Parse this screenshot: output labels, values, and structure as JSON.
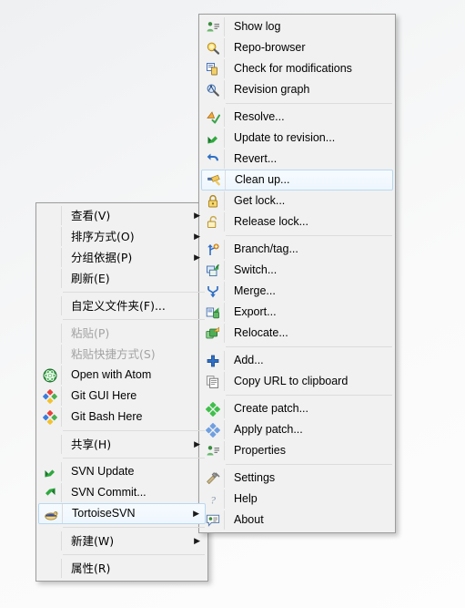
{
  "context_menu": {
    "name": "explorer-folder-context-menu",
    "items": [
      {
        "label": "查看(V)",
        "icon": null,
        "submenu": true,
        "disabled": false,
        "selected": false
      },
      {
        "label": "排序方式(O)",
        "icon": null,
        "submenu": true,
        "disabled": false,
        "selected": false
      },
      {
        "label": "分组依据(P)",
        "icon": null,
        "submenu": true,
        "disabled": false,
        "selected": false
      },
      {
        "label": "刷新(E)",
        "icon": null,
        "submenu": false,
        "disabled": false,
        "selected": false
      },
      {
        "separator": true
      },
      {
        "label": "自定义文件夹(F)...",
        "icon": null,
        "submenu": false,
        "disabled": false,
        "selected": false
      },
      {
        "separator": true
      },
      {
        "label": "粘贴(P)",
        "icon": null,
        "submenu": false,
        "disabled": true,
        "selected": false
      },
      {
        "label": "粘贴快捷方式(S)",
        "icon": null,
        "submenu": false,
        "disabled": true,
        "selected": false
      },
      {
        "label": "Open with Atom",
        "icon": "atom-icon",
        "submenu": false,
        "disabled": false,
        "selected": false
      },
      {
        "label": "Git GUI Here",
        "icon": "git-icon",
        "submenu": false,
        "disabled": false,
        "selected": false
      },
      {
        "label": "Git Bash Here",
        "icon": "git-icon",
        "submenu": false,
        "disabled": false,
        "selected": false
      },
      {
        "separator": true
      },
      {
        "label": "共享(H)",
        "icon": null,
        "submenu": true,
        "disabled": false,
        "selected": false
      },
      {
        "separator": true
      },
      {
        "label": "SVN Update",
        "icon": "svn-update-icon",
        "submenu": false,
        "disabled": false,
        "selected": false
      },
      {
        "label": "SVN Commit...",
        "icon": "svn-commit-icon",
        "submenu": false,
        "disabled": false,
        "selected": false
      },
      {
        "label": "TortoiseSVN",
        "icon": "tortoise-icon",
        "submenu": true,
        "disabled": false,
        "selected": true
      },
      {
        "separator": true
      },
      {
        "label": "新建(W)",
        "icon": null,
        "submenu": true,
        "disabled": false,
        "selected": false
      },
      {
        "separator": true
      },
      {
        "label": "属性(R)",
        "icon": null,
        "submenu": false,
        "disabled": false,
        "selected": false
      }
    ]
  },
  "tortoise_submenu": {
    "name": "tortoisesvn-submenu",
    "items": [
      {
        "label": "Show log",
        "icon": "show-log-icon",
        "submenu": false,
        "disabled": false,
        "selected": false
      },
      {
        "label": "Repo-browser",
        "icon": "repo-browser-icon",
        "submenu": false,
        "disabled": false,
        "selected": false
      },
      {
        "label": "Check for modifications",
        "icon": "check-mods-icon",
        "submenu": false,
        "disabled": false,
        "selected": false
      },
      {
        "label": "Revision graph",
        "icon": "revision-graph-icon",
        "submenu": false,
        "disabled": false,
        "selected": false
      },
      {
        "separator": true
      },
      {
        "label": "Resolve...",
        "icon": "resolve-icon",
        "submenu": false,
        "disabled": false,
        "selected": false
      },
      {
        "label": "Update to revision...",
        "icon": "update-rev-icon",
        "submenu": false,
        "disabled": false,
        "selected": false
      },
      {
        "label": "Revert...",
        "icon": "revert-icon",
        "submenu": false,
        "disabled": false,
        "selected": false
      },
      {
        "label": "Clean up...",
        "icon": "cleanup-icon",
        "submenu": false,
        "disabled": false,
        "selected": true
      },
      {
        "label": "Get lock...",
        "icon": "lock-closed-icon",
        "submenu": false,
        "disabled": false,
        "selected": false
      },
      {
        "label": "Release lock...",
        "icon": "lock-open-icon",
        "submenu": false,
        "disabled": false,
        "selected": false
      },
      {
        "separator": true
      },
      {
        "label": "Branch/tag...",
        "icon": "branch-tag-icon",
        "submenu": false,
        "disabled": false,
        "selected": false
      },
      {
        "label": "Switch...",
        "icon": "switch-icon",
        "submenu": false,
        "disabled": false,
        "selected": false
      },
      {
        "label": "Merge...",
        "icon": "merge-icon",
        "submenu": false,
        "disabled": false,
        "selected": false
      },
      {
        "label": "Export...",
        "icon": "export-icon",
        "submenu": false,
        "disabled": false,
        "selected": false
      },
      {
        "label": "Relocate...",
        "icon": "relocate-icon",
        "submenu": false,
        "disabled": false,
        "selected": false
      },
      {
        "separator": true
      },
      {
        "label": "Add...",
        "icon": "add-icon",
        "submenu": false,
        "disabled": false,
        "selected": false
      },
      {
        "label": "Copy URL to clipboard",
        "icon": "copy-url-icon",
        "submenu": false,
        "disabled": false,
        "selected": false
      },
      {
        "separator": true
      },
      {
        "label": "Create patch...",
        "icon": "create-patch-icon",
        "submenu": false,
        "disabled": false,
        "selected": false
      },
      {
        "label": "Apply patch...",
        "icon": "apply-patch-icon",
        "submenu": false,
        "disabled": false,
        "selected": false
      },
      {
        "label": "Properties",
        "icon": "properties-icon",
        "submenu": false,
        "disabled": false,
        "selected": false
      },
      {
        "separator": true
      },
      {
        "label": "Settings",
        "icon": "settings-icon",
        "submenu": false,
        "disabled": false,
        "selected": false
      },
      {
        "label": "Help",
        "icon": "help-icon",
        "submenu": false,
        "disabled": false,
        "selected": false
      },
      {
        "label": "About",
        "icon": "about-icon",
        "submenu": false,
        "disabled": false,
        "selected": false
      }
    ]
  },
  "glyphs": {
    "submenu_arrow": "▶"
  },
  "colors": {
    "menu_background": "#f1f1f1",
    "menu_border": "#9c9c9c",
    "highlight_fill": "#eef6fd",
    "highlight_border": "#b9d8f0",
    "separator": "#dcdcdc",
    "disabled_text": "#a3a3a3",
    "text": "#000000"
  }
}
